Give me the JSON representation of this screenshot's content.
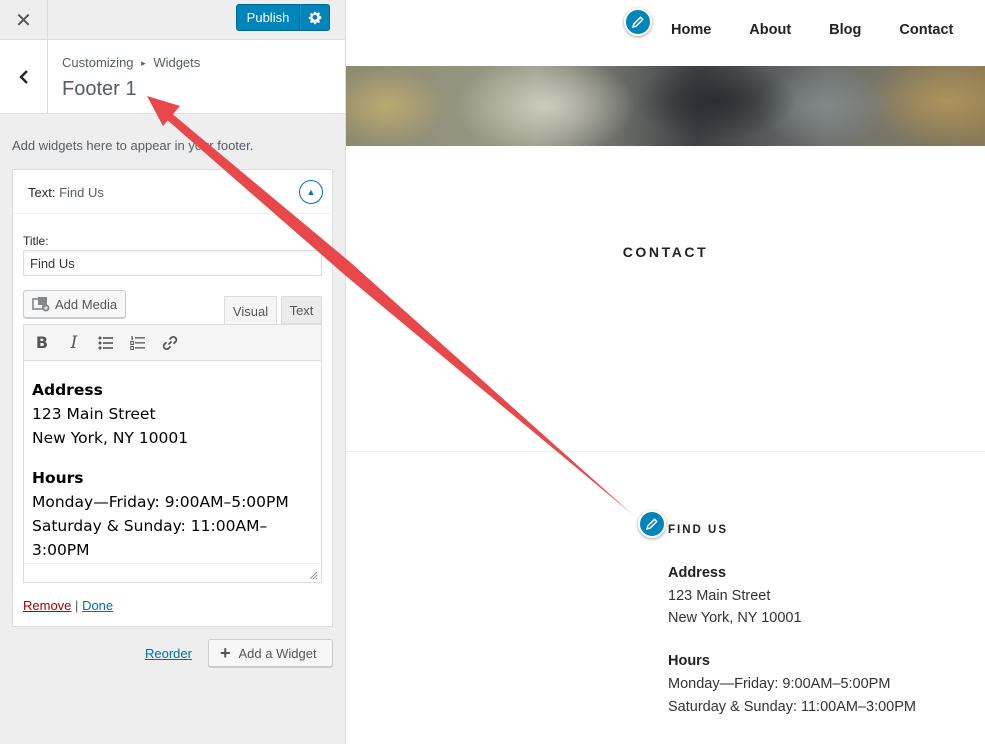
{
  "topbar": {
    "close_glyph": "✕",
    "publish_label": "Publish",
    "settings_icon": "gear-icon"
  },
  "section": {
    "breadcrumb_parent": "Customizing",
    "breadcrumb_sep": "▸",
    "breadcrumb_current": "Widgets",
    "title": "Footer 1",
    "description": "Add widgets here to appear in your footer."
  },
  "widget": {
    "type_label": "Text:",
    "name": "Find Us",
    "title_label": "Title:",
    "title_value": "Find Us",
    "add_media_label": "Add Media",
    "tab_visual": "Visual",
    "tab_text": "Text",
    "toolbar": [
      "bold-icon",
      "italic-icon",
      "bullet-list-icon",
      "numbered-list-icon",
      "link-icon"
    ],
    "content": {
      "address_heading": "Address",
      "address_line1": "123 Main Street",
      "address_line2": "New York, NY 10001",
      "hours_heading": "Hours",
      "hours_line1": "Monday—Friday: 9:00AM–5:00PM",
      "hours_line2": "Saturday & Sunday: 11:00AM–3:00PM"
    },
    "remove_label": "Remove",
    "actions_sep": "|",
    "done_label": "Done"
  },
  "footer_actions": {
    "reorder_label": "Reorder",
    "add_widget_label": "Add a Widget"
  },
  "preview": {
    "nav": [
      "Home",
      "About",
      "Blog",
      "Contact"
    ],
    "page_heading": "CONTACT",
    "footer_widget_title": "FIND US",
    "footer": {
      "address_heading": "Address",
      "address_line1": "123 Main Street",
      "address_line2": "New York, NY 10001",
      "hours_heading": "Hours",
      "hours_line1": "Monday—Friday: 9:00AM–5:00PM",
      "hours_line2": "Saturday & Sunday: 11:00AM–3:00PM"
    }
  },
  "colors": {
    "primary": "#0085ba",
    "link": "#0073aa",
    "remove": "#aa0000",
    "annotation_arrow": "#e8484a"
  }
}
